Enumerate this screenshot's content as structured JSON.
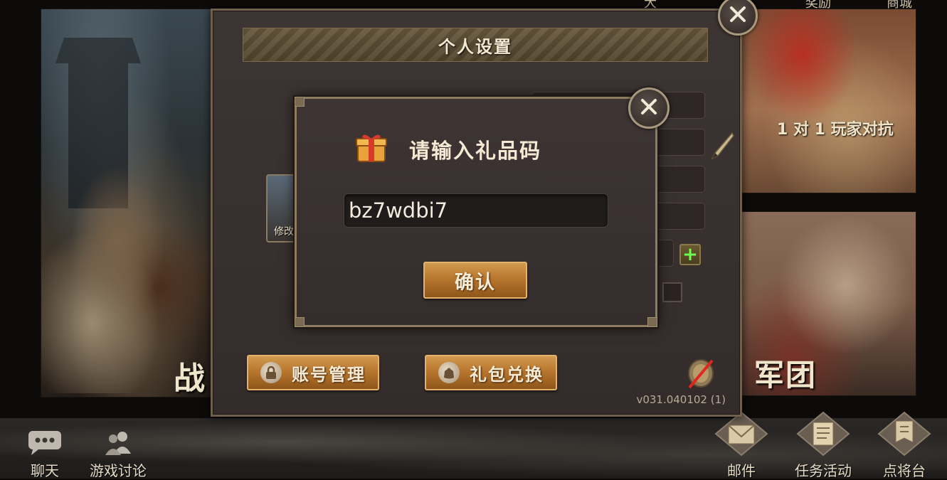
{
  "background": {
    "top_partial_texts": [
      "大",
      "奖励",
      "商城"
    ],
    "left_panel_label": "战",
    "right_top_label": "1 对 1 玩家对抗",
    "right_bottom_label": "军团"
  },
  "bottom_bar": {
    "items": [
      {
        "label": "聊天",
        "icon": "chat-bubble-icon"
      },
      {
        "label": "游戏讨论",
        "icon": "people-icon"
      },
      {
        "label": "邮件",
        "icon": "envelope-icon"
      },
      {
        "label": "任务活动",
        "icon": "scroll-icon"
      },
      {
        "label": "点将台",
        "icon": "general-banner-icon"
      }
    ]
  },
  "settings": {
    "title": "个人设置",
    "avatar_label": "修改",
    "account_button": "账号管理",
    "gift_button": "礼包兑换",
    "version": "v031.040102 (1)",
    "accent_color": "#b9772e"
  },
  "gift_dialog": {
    "title": "请输入礼品码",
    "code_value": "bz7wdbi7",
    "confirm_button": "确认"
  }
}
